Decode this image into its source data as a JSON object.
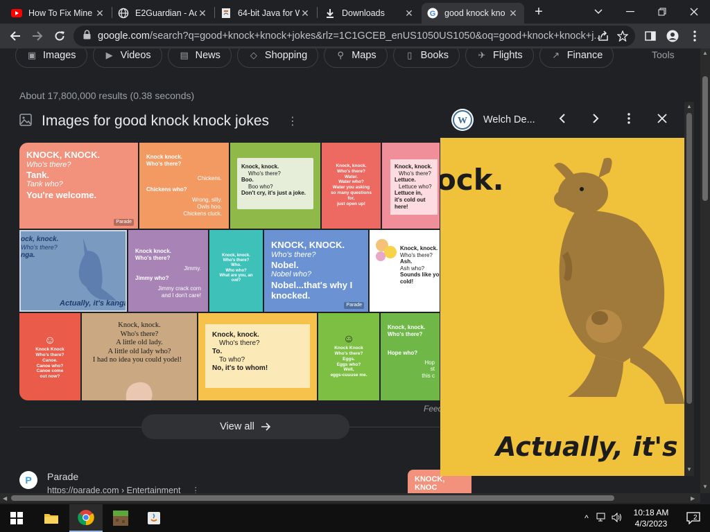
{
  "tabs": [
    {
      "title": "How To Fix Mine",
      "icon": "youtube-icon"
    },
    {
      "title": "E2Guardian - Ac",
      "icon": "globe-icon"
    },
    {
      "title": "64-bit Java for W",
      "icon": "java-doc-icon"
    },
    {
      "title": "Downloads",
      "icon": "download-icon"
    },
    {
      "title": "good knock kno",
      "icon": "google-icon"
    }
  ],
  "close_glyph": "✕",
  "newtab_glyph": "+",
  "omnibox": {
    "host": "google.com",
    "path": "/search?q=good+knock+knock+jokes&rlz=1C1GCEB_enUS1050US1050&oq=good+knock+knock+j..."
  },
  "chips": [
    {
      "label": "Images",
      "icon": "image-icon"
    },
    {
      "label": "Videos",
      "icon": "video-icon"
    },
    {
      "label": "News",
      "icon": "news-icon"
    },
    {
      "label": "Shopping",
      "icon": "tag-icon"
    },
    {
      "label": "Maps",
      "icon": "map-pin-icon"
    },
    {
      "label": "Books",
      "icon": "book-icon"
    },
    {
      "label": "Flights",
      "icon": "plane-icon"
    },
    {
      "label": "Finance",
      "icon": "finance-icon"
    }
  ],
  "tools_label": "Tools",
  "result_count": "About 17,800,000 results (0.38 seconds)",
  "images_heading": "Images for good knock knock jokes",
  "tiles": [
    {
      "lines": [
        "KNOCK, KNOCK.",
        "Who's there?",
        "Tank.",
        "Tank who?",
        "You're welcome."
      ],
      "source": "Parade"
    },
    {
      "lines": [
        "Knock knock.",
        "Who's there?",
        "Chickens.",
        "Chickens who?",
        "Wrong, silly.",
        "Owls hoo.",
        "Chickens cluck."
      ]
    },
    {
      "lines": [
        "Knock, knock.",
        "Who's there?",
        "Boo.",
        "Boo who?",
        "Don't cry, it's just a joke."
      ]
    },
    {
      "lines": [
        "Knock, knock.",
        "Who's there?",
        "Water.",
        "Water who?",
        "Water you asking",
        "so many questions for,",
        "just open up!"
      ]
    },
    {
      "lines": [
        "Knock, knock.",
        "Who's there?",
        "Lettuce.",
        "Lettuce who?",
        "Lettuce in,",
        "it's cold out here!"
      ]
    },
    {
      "lines": [
        "ock, knock.",
        "Who's there?",
        "nga.",
        "Actually, it's kanga"
      ]
    },
    {
      "lines": [
        "Knock knock.",
        "Who's there?",
        "Jimmy.",
        "Jimmy who?",
        "Jimmy crack corn",
        "and I don't care!"
      ]
    },
    {
      "lines": [
        "Knock, knock.",
        "Who's there?",
        "Who.",
        "Who who?",
        "What are you, an owl?"
      ]
    },
    {
      "lines": [
        "KNOCK, KNOCK.",
        "Who's there?",
        "Nobel.",
        "Nobel who?",
        "Nobel...that's why I",
        "knocked."
      ],
      "source": "Parade"
    },
    {
      "lines": [
        "Knock, knock.",
        "Who's there?",
        "Ash.",
        "Ash who?",
        "Sounds like you h",
        "cold!"
      ]
    },
    {
      "lines": [
        "Knock Knock",
        "Who's there?",
        "Canoe.",
        "Canoe who?",
        "Canoe come",
        "out now?"
      ]
    },
    {
      "lines": [
        "Knock, knock.",
        "Who's there?",
        "A little old lady.",
        "A little old lady who?",
        "I had no idea you could yodel!"
      ]
    },
    {
      "lines": [
        "Knock, knock.",
        "Who's there?",
        "To.",
        "To who?",
        "No, it's to whom!"
      ]
    },
    {
      "lines": [
        "Knock Knock",
        "Who's there?",
        "Eggs.",
        "Eggs who?",
        "Well,",
        "eggs-cuuuse me."
      ]
    },
    {
      "lines": [
        "Knock, knock.",
        "Who's there?",
        "Hope who?",
        "Hop",
        "st",
        "this c"
      ]
    }
  ],
  "feedback": "Feed",
  "view_all": "View all",
  "result": {
    "site": "Parade",
    "url": "https://parade.com › Entertainment"
  },
  "thumb_small_text": "KNOCK, KNOC",
  "preview": {
    "site_name": "Welch De...",
    "image_top_text": "ock.",
    "image_bottom_text": "Actually, it's"
  },
  "taskbar": {
    "time": "10:18 AM",
    "date": "4/3/2023",
    "notification_count": "2"
  },
  "colors": {
    "page_bg": "#202124",
    "toolbar_bg": "#35363a",
    "preview_image_bg": "#f0c13a",
    "kangaroo": "#a07a3a"
  }
}
